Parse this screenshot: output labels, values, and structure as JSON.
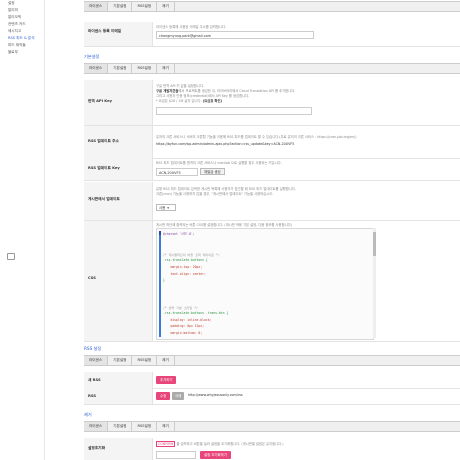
{
  "sidebar": {
    "items": [
      {
        "label": "설정"
      },
      {
        "label": "알리미"
      },
      {
        "label": "알리오픽"
      },
      {
        "label": "컨텐츠 카드"
      },
      {
        "label": "메시지고"
      },
      {
        "label": "RSS 피드 & 분석"
      },
      {
        "label": "피드 제작들"
      },
      {
        "label": "블로부"
      }
    ]
  },
  "tabs_common": [
    "라이센스",
    "기본설정",
    "RSS설정",
    "제거"
  ],
  "license": {
    "label": "라이센스 등록 이메일",
    "desc": "라이센스 등록에 사용된 이메일 주소를 입력합니다.",
    "email": "chongmyung.park@gmail.com"
  },
  "basic": {
    "title": "기본설정",
    "api": {
      "label": "번역 API Key",
      "desc1": "구글 번역 API 키 값을 설정합니다.",
      "desc2_bold": "구글 개발자콘솔",
      "desc2_rest": "에서 프로젝트를 생성한 뒤, 라이브러리에서 Cloud Translation API 를 추가합니다.",
      "desc3": "그리고 사용자 인증 정보(credential)에서 API Key 를 생성합니다.",
      "desc4_pre": "* 요금은 $20 / 1M 글자 입니다. ",
      "desc4_bold": "(요금표 확인)"
    },
    "rss_addr": {
      "label": "RSS 업데이트 주소",
      "desc": "유저의 크론 서비스나 서버의 크론탭 기능을 이용해 RSS 피드를 업데이트 할 수 있습니다.(무료 유저의 크론 서비스 : https://cron-job.org/en/)",
      "url": "https://byfun.com/wp-admin/admin-ajax.php?action=rss_update&key=ACN-20UVF5"
    },
    "rss_key": {
      "label": "RSS 업데이트 Key",
      "desc": "RSS 피드 업데이트를 원격의 크론 서비스나 crontab 으로 실행할 경우 사용되는 키입니다.",
      "value": "ACN-20UVF5",
      "button": "재발급 생성"
    },
    "menu": {
      "label": "게시판에서 업데이트",
      "desc1": "유형 RSS 피드 업데이트 입력한 게시판 목록에 사용자가 접근할 때 RSS 피드 업데이트를 실행합니다.",
      "desc2": "크론(cron) 기능을 사용하지 않을 경우, \"게시판에서 업데이트\" 기능을 사용하십시오.",
      "select": "사용"
    },
    "css": {
      "label": "CSS",
      "desc": "게시판 하단에 출력되는 버튼 CSS를 설정합니다. (게시판 적용 기본 설정, 다음 정보를 사용합니다)",
      "lines": [
        {
          "t": "@charset 'UTF-8';",
          "c": "c-kw"
        },
        {
          "t": "",
          "c": ""
        },
        {
          "t": "",
          "c": ""
        },
        {
          "t": "/* 게시물하단의 버튼 출력 레이아웃 */",
          "c": "c-com"
        },
        {
          "t": ".rss-translate-buttons {",
          "c": "c-sel"
        },
        {
          "t": "    margin-top: 20px;",
          "c": "c-prop"
        },
        {
          "t": "    text-align: center;",
          "c": "c-prop"
        },
        {
          "t": "}",
          "c": "c-sel"
        },
        {
          "t": "",
          "c": ""
        },
        {
          "t": "",
          "c": ""
        },
        {
          "t": "",
          "c": ""
        },
        {
          "t": "/* 번역 기본 스타일 */",
          "c": "c-com"
        },
        {
          "t": ".rss-translate-buttons .trans-btn {",
          "c": "c-sel"
        },
        {
          "t": "    display: inline-block;",
          "c": "c-prop"
        },
        {
          "t": "    padding: 0px 12px;",
          "c": "c-prop"
        },
        {
          "t": "    margin-bottom: 0;",
          "c": "c-prop"
        }
      ]
    }
  },
  "rss": {
    "title": "RSS 설정",
    "new_rss": {
      "label": "새 RSS",
      "button": "추가하기"
    },
    "item": {
      "label": "RSS",
      "edit": "수정",
      "delete": "삭제",
      "url": "http://www.whyjesusonly.com/rss"
    }
  },
  "remove": {
    "title": "제거",
    "label": "설정초기화",
    "desc_badge": "CONFIRM",
    "desc": "을 입력하고 버튼을 눌러 설정을 초기화합니다. (게시판별 설정은 유지됩니다.)",
    "button": "설정 초기화하기"
  }
}
